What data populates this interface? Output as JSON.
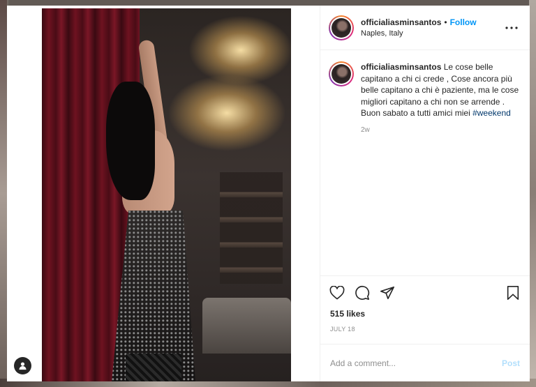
{
  "post": {
    "username": "officialiasminsantos",
    "separator": "•",
    "follow_label": "Follow",
    "location": "Naples, Italy",
    "more_icon": "more-horizontal-icon"
  },
  "caption": {
    "username": "officialiasminsantos",
    "text": "Le cose belle capitano a chi ci crede , Cose ancora più belle capitano a chi è paziente, ma le cose migliori capitano a chi non se arrende . Buon sabato a tutti amici miei",
    "hashtag": "#weekend",
    "time_ago": "2w"
  },
  "actions": {
    "like_icon": "heart-icon",
    "comment_icon": "comment-icon",
    "share_icon": "share-icon",
    "save_icon": "bookmark-icon"
  },
  "likes": "515 likes",
  "date": "JULY 18",
  "comment_box": {
    "placeholder": "Add a comment...",
    "post_label": "Post"
  },
  "colors": {
    "accent": "#0095f6",
    "post_disabled": "#b2dffc",
    "hashtag": "#00376b"
  }
}
